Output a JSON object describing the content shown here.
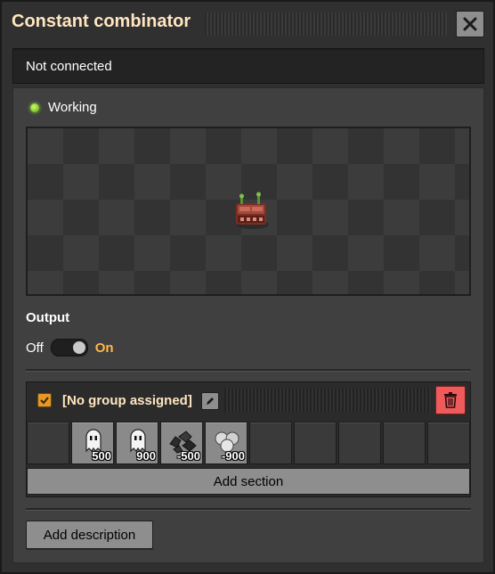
{
  "window": {
    "title": "Constant combinator"
  },
  "connection": {
    "status_text": "Not connected"
  },
  "status": {
    "text": "Working",
    "indicator_color": "#7ed321"
  },
  "output": {
    "label": "Output",
    "toggle_off_label": "Off",
    "toggle_on_label": "On",
    "state": "on"
  },
  "section": {
    "group_label": "[No group assigned]",
    "checked": true,
    "slots": [
      {
        "icon": "empty",
        "count": ""
      },
      {
        "icon": "ghost-signal-icon",
        "count": "500"
      },
      {
        "icon": "ghost-signal-icon",
        "count": "900"
      },
      {
        "icon": "coal-icon",
        "count": "-500"
      },
      {
        "icon": "stone-icon",
        "count": "-900"
      },
      {
        "icon": "empty",
        "count": ""
      },
      {
        "icon": "empty",
        "count": ""
      },
      {
        "icon": "empty",
        "count": ""
      },
      {
        "icon": "empty",
        "count": ""
      },
      {
        "icon": "empty",
        "count": ""
      }
    ],
    "add_section_label": "Add section"
  },
  "add_description_label": "Add description",
  "colors": {
    "accent": "#ffb845",
    "title": "#ffe6c0",
    "delete": "#ef5b5b",
    "checkbox": "#e39827"
  }
}
